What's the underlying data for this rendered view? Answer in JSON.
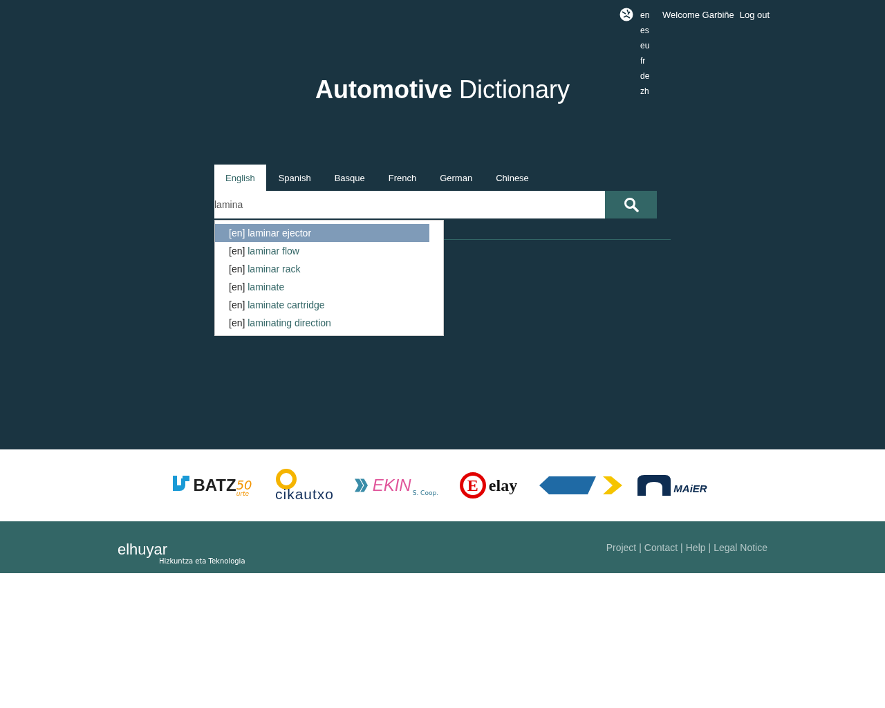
{
  "top_bar": {
    "languages": [
      {
        "code": "en"
      },
      {
        "code": "es"
      },
      {
        "code": "eu"
      },
      {
        "code": "fr"
      },
      {
        "code": "de"
      },
      {
        "code": "zh"
      }
    ],
    "welcome": "Welcome Garbiñe",
    "logout": "Log out"
  },
  "title": {
    "bold": "Automotive",
    "rest": "Dictionary"
  },
  "tabs": [
    {
      "label": "English",
      "selected": true
    },
    {
      "label": "Spanish",
      "selected": false
    },
    {
      "label": "Basque",
      "selected": false
    },
    {
      "label": "French",
      "selected": false
    },
    {
      "label": "German",
      "selected": false
    },
    {
      "label": "Chinese",
      "selected": false
    }
  ],
  "search": {
    "value": "lamina"
  },
  "suggestions": [
    {
      "lang": "[en]",
      "term": "laminar ejector",
      "selected": true
    },
    {
      "lang": "[en]",
      "term": "laminar flow",
      "selected": false
    },
    {
      "lang": "[en]",
      "term": "laminar rack",
      "selected": false
    },
    {
      "lang": "[en]",
      "term": "laminate",
      "selected": false
    },
    {
      "lang": "[en]",
      "term": "laminate cartridge",
      "selected": false
    },
    {
      "lang": "[en]",
      "term": "laminating direction",
      "selected": false
    }
  ],
  "sponsors": [
    {
      "kind": "batz",
      "text": "BATZ",
      "extra": "50",
      "small": "urte"
    },
    {
      "kind": "cikautxo",
      "text": "cikautxo"
    },
    {
      "kind": "ekin",
      "text": "EKIN",
      "small": "S. Coop."
    },
    {
      "kind": "elay",
      "text": "elay",
      "extra": "E"
    },
    {
      "kind": "gkn"
    },
    {
      "kind": "maier",
      "text": "MAiER"
    }
  ],
  "footer": {
    "brand": "elhuyar",
    "tagline": "Hizkuntza eta Teknologia",
    "separator": "|",
    "links": [
      "Project",
      "Contact",
      "Help",
      "Legal Notice"
    ]
  }
}
